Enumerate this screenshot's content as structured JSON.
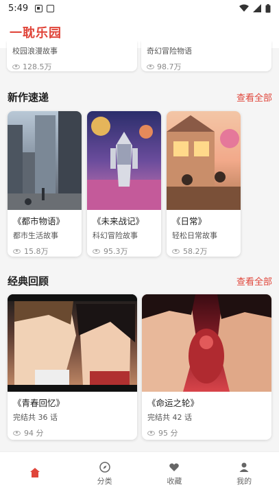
{
  "status_bar": {
    "time": "5:49"
  },
  "header": {
    "title": "一耽乐园"
  },
  "prev_cards": [
    {
      "desc": "校园浪漫故事",
      "views": "128.5万"
    },
    {
      "desc": "奇幻冒险物语",
      "views": "98.7万"
    }
  ],
  "sections": {
    "new": {
      "title": "新作速递",
      "see_all": "查看全部",
      "cards": [
        {
          "title": "《都市物语》",
          "desc": "都市生活故事",
          "views": "15.8万",
          "image": "city-street-scene"
        },
        {
          "title": "《未来战记》",
          "desc": "科幻冒险故事",
          "views": "95.3万",
          "image": "mecha-robot-scene"
        },
        {
          "title": "《日常》",
          "desc": "轻松日常故事",
          "views": "58.2万",
          "image": "evening-house-scene"
        }
      ]
    },
    "classic": {
      "title": "经典回顾",
      "see_all": "查看全部",
      "cards": [
        {
          "title": "《青春回忆》",
          "desc": "完结共 36 话",
          "score": "94 分",
          "image": "anime-couple-scene"
        },
        {
          "title": "《命运之轮》",
          "desc": "完结共 42 话",
          "score": "95 分",
          "image": "rival-faceoff-scene"
        }
      ]
    }
  },
  "bottom_nav": {
    "items": [
      {
        "label": "",
        "icon": "home-icon",
        "active": true
      },
      {
        "label": "分类",
        "icon": "compass-icon",
        "active": false
      },
      {
        "label": "收藏",
        "icon": "heart-icon",
        "active": false
      },
      {
        "label": "我的",
        "icon": "user-icon",
        "active": false
      }
    ]
  },
  "colors": {
    "accent": "#e0453a",
    "background": "#f5f5f5"
  }
}
